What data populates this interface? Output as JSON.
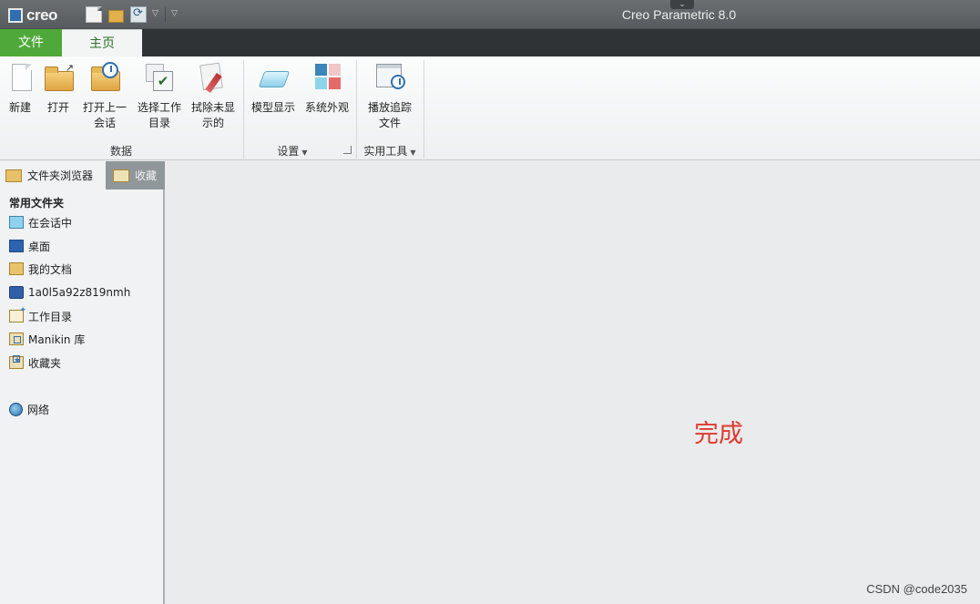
{
  "titlebar": {
    "logo_text": "creo",
    "app_title": "Creo Parametric 8.0",
    "quick_access_icons": [
      "new-file-icon",
      "open-folder-icon",
      "regenerate-icon"
    ],
    "dropdown_glyph": "▽",
    "collapse_glyph": "⌄"
  },
  "tabs": {
    "file": "文件",
    "home": "主页"
  },
  "ribbon": {
    "data_group": {
      "label": "数据",
      "buttons": [
        {
          "label_line1": "新建",
          "label_line2": "",
          "icon": "new-document-icon"
        },
        {
          "label_line1": "打开",
          "label_line2": "",
          "icon": "open-folder-icon"
        },
        {
          "label_line1": "打开上一",
          "label_line2": "会话",
          "icon": "open-last-session-icon"
        },
        {
          "label_line1": "选择工作",
          "label_line2": "目录",
          "icon": "select-working-directory-icon"
        },
        {
          "label_line1": "拭除未显",
          "label_line2": "示的",
          "icon": "erase-not-displayed-icon"
        }
      ]
    },
    "settings_group": {
      "label": "设置",
      "buttons": [
        {
          "label": "模型显示",
          "icon": "model-display-icon"
        },
        {
          "label": "系统外观",
          "icon": "system-appearance-icon"
        }
      ]
    },
    "utilities_group": {
      "label": "实用工具",
      "buttons": [
        {
          "label_line1": "播放追踪",
          "label_line2": "文件",
          "icon": "play-trail-file-icon"
        }
      ]
    }
  },
  "navigator": {
    "tab_browser": "文件夹浏览器",
    "tab_favorites": "收藏",
    "heading": "常用文件夹",
    "items": [
      {
        "label": "在会话中",
        "icon": "in-session-icon"
      },
      {
        "label": "桌面",
        "icon": "desktop-icon"
      },
      {
        "label": "我的文档",
        "icon": "my-documents-icon"
      },
      {
        "label": "1a0l5a92z819nmh",
        "icon": "computer-icon"
      },
      {
        "label": "工作目录",
        "icon": "working-directory-icon"
      },
      {
        "label": "Manikin 库",
        "icon": "manikin-library-icon"
      },
      {
        "label": "收藏夹",
        "icon": "favorites-icon"
      },
      {
        "label": "网络",
        "icon": "network-icon"
      }
    ]
  },
  "main": {
    "overlay_text": "完成"
  },
  "watermark": "CSDN @code2035",
  "colors": {
    "file_tab": "#4fa93a",
    "titlebar": "#5f6366",
    "overlay_text": "#e03a2f"
  }
}
